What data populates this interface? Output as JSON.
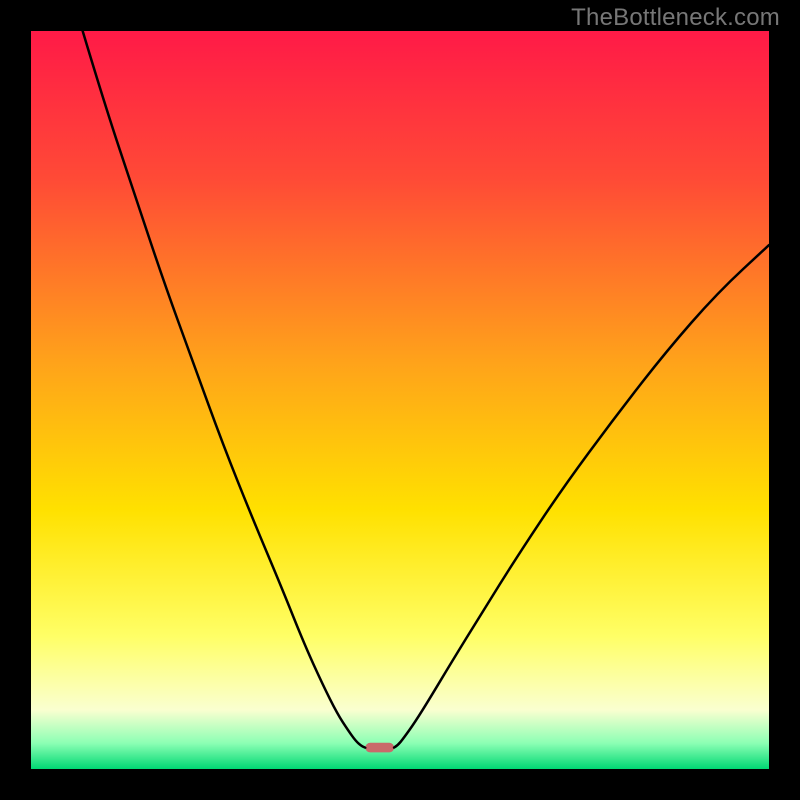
{
  "attribution": "TheBottleneck.com",
  "chart_data": {
    "type": "line",
    "title": "",
    "xlabel": "",
    "ylabel": "",
    "xlim": [
      0,
      100
    ],
    "ylim": [
      0,
      100
    ],
    "axes_visible": false,
    "background_gradient_stops": [
      {
        "offset": 0.0,
        "color": "#ff1a47"
      },
      {
        "offset": 0.2,
        "color": "#ff4a36"
      },
      {
        "offset": 0.45,
        "color": "#ffa31a"
      },
      {
        "offset": 0.65,
        "color": "#ffe100"
      },
      {
        "offset": 0.82,
        "color": "#ffff66"
      },
      {
        "offset": 0.92,
        "color": "#faffd0"
      },
      {
        "offset": 0.965,
        "color": "#8cffb4"
      },
      {
        "offset": 1.0,
        "color": "#00d873"
      }
    ],
    "series": [
      {
        "name": "left-curve",
        "color": "#000000",
        "x": [
          7,
          10,
          14,
          18,
          22,
          26,
          30,
          34,
          37,
          39.5,
          41.5,
          43,
          44,
          44.8,
          45.3
        ],
        "y": [
          100,
          90,
          78,
          66,
          55,
          44,
          34,
          24.5,
          17,
          11.5,
          7.5,
          5.2,
          3.8,
          3.1,
          2.9
        ]
      },
      {
        "name": "right-curve",
        "color": "#000000",
        "x": [
          49.2,
          49.7,
          50.5,
          52,
          54,
          57,
          61,
          66,
          72,
          79,
          86,
          93,
          100
        ],
        "y": [
          2.9,
          3.2,
          4.2,
          6.3,
          9.5,
          14.5,
          21,
          29,
          38,
          47.5,
          56.5,
          64.5,
          71
        ]
      }
    ],
    "marker": {
      "name": "bottom-marker",
      "color": "#c96a6a",
      "x_center": 47.25,
      "width_pct": 3.9,
      "y_center": 2.9,
      "height_pct": 1.3
    }
  }
}
